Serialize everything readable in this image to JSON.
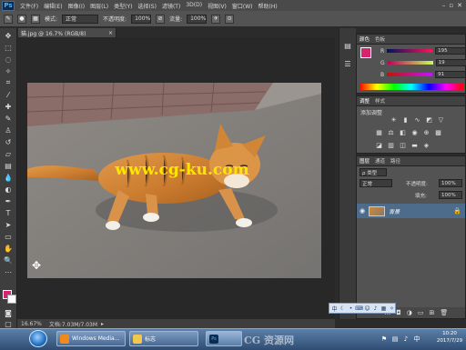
{
  "app": {
    "logo": "Ps"
  },
  "menubar": {
    "items": [
      "文件(F)",
      "编辑(E)",
      "图像(I)",
      "图层(L)",
      "类型(Y)",
      "选择(S)",
      "滤镜(T)",
      "3D(D)",
      "视图(V)",
      "窗口(W)",
      "帮助(H)"
    ]
  },
  "options": {
    "mode_label": "模式:",
    "mode_value": "正常",
    "opacity_label": "不透明度:",
    "opacity_value": "100%",
    "flow_label": "流量:",
    "flow_value": "100%"
  },
  "document": {
    "tab_label": "猫.jpg @ 16.7% (RGB/8)",
    "watermark_text": "www.cg-ku.com",
    "zoom": "16.67%",
    "doc_info": "文档:7.03M/7.03M"
  },
  "color_panel": {
    "tabs": [
      "颜色",
      "色板"
    ],
    "r_label": "R",
    "r_value": "195",
    "g_label": "G",
    "g_value": "19",
    "b_label": "B",
    "b_value": "91",
    "fg_color": "#d6246e"
  },
  "adjustments_panel": {
    "tabs": [
      "调整",
      "样式"
    ],
    "title": "添加调整"
  },
  "layers_panel": {
    "tabs": [
      "图层",
      "通道",
      "路径"
    ],
    "blend_mode": "正常",
    "opacity_label": "不透明度:",
    "opacity_value": "100%",
    "fill_label": "填充:",
    "fill_value": "100%",
    "layer_name": "背景"
  },
  "taskbar": {
    "tasks": [
      {
        "label": "Windows Media..."
      },
      {
        "label": "标志"
      },
      {
        "label": ""
      }
    ],
    "watermark": "CG 资源网",
    "clock_time": "10:20",
    "clock_date": "2017/7/29"
  },
  "colors": {
    "ps_blue": "#4fb1ff",
    "panel_bg": "#535353",
    "selection": "#4d6b8a"
  }
}
